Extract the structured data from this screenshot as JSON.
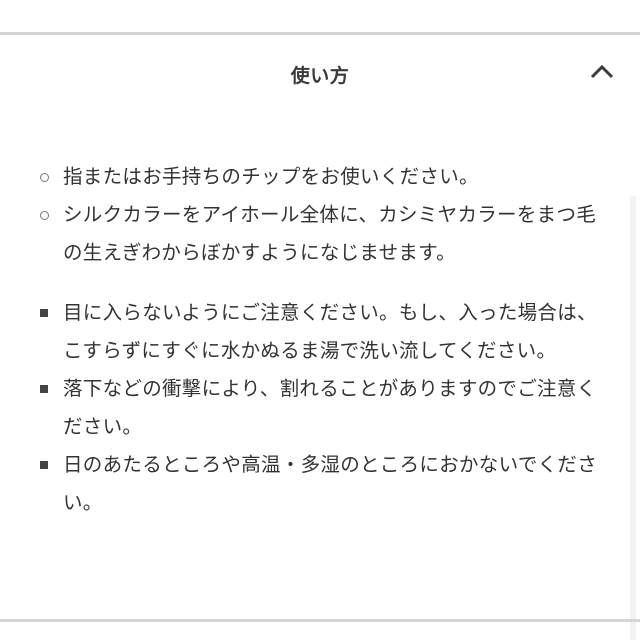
{
  "accordion": {
    "title": "使い方",
    "toggle_icon": "chevron-up-icon",
    "expanded": true
  },
  "usage": {
    "items": [
      {
        "bullet": "circle",
        "text": "指またはお手持ちのチップをお使いください。"
      },
      {
        "bullet": "circle",
        "text": "シルクカラーをアイホール全体に、カシミヤカラーをまつ毛の生えぎわからぼかすようになじませます。"
      }
    ]
  },
  "cautions": {
    "items": [
      {
        "bullet": "square",
        "text": "目に入らないようにご注意ください。もし、入った場合は、こすらずにすぐに水かぬるま湯で洗い流してください。"
      },
      {
        "bullet": "square",
        "text": "落下などの衝撃により、割れることがありますのでご注意ください。"
      },
      {
        "bullet": "square",
        "text": "日のあたるところや高温・多湿のところにおかないでください。"
      }
    ]
  }
}
